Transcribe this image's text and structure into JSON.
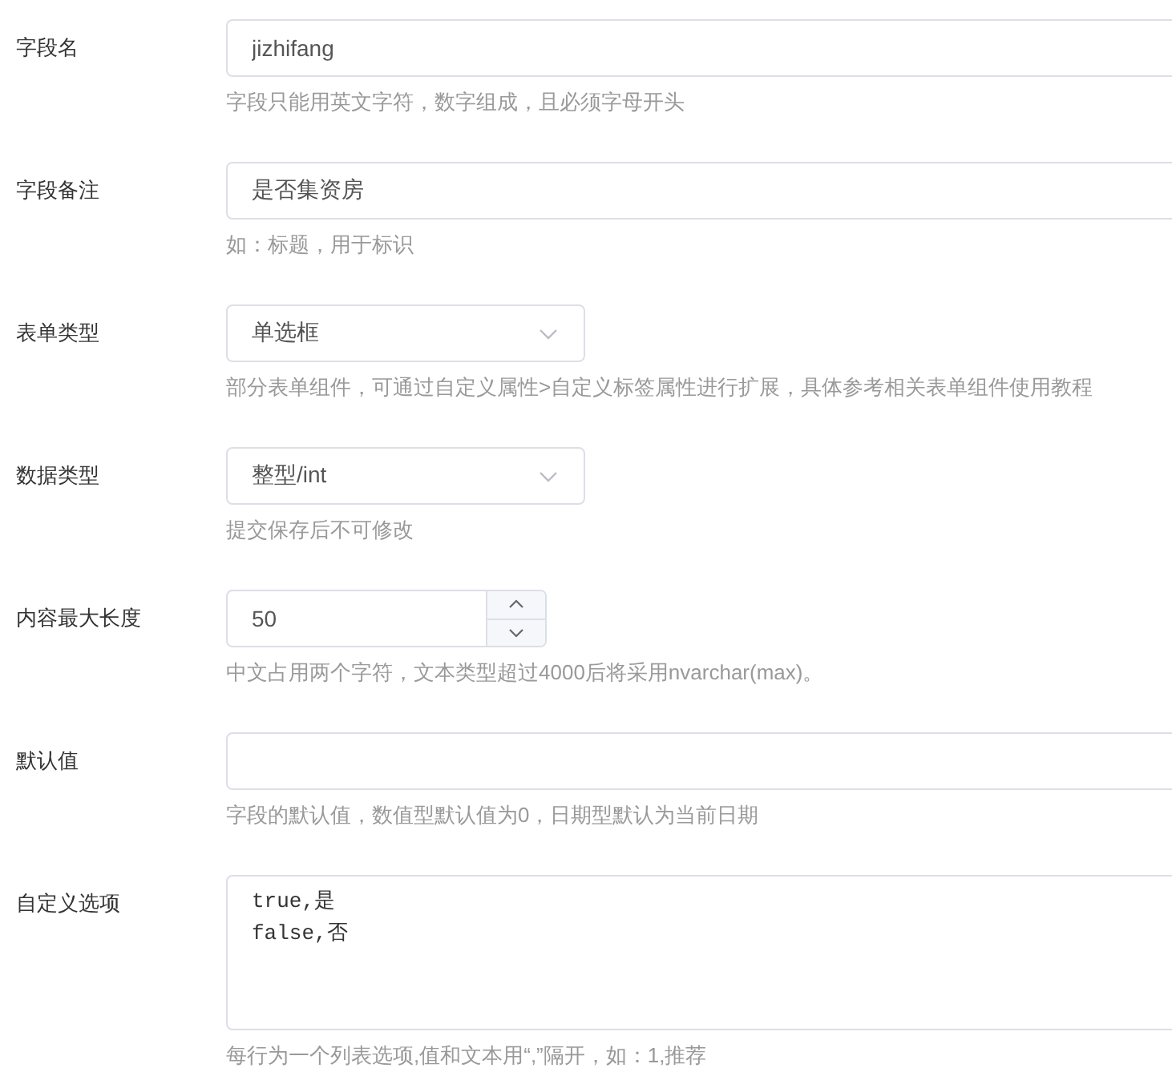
{
  "fields": [
    {
      "kind": "text",
      "label": "字段名",
      "value": "jizhifang",
      "help": "字段只能用英文字符，数字组成，且必须字母开头"
    },
    {
      "kind": "text",
      "label": "字段备注",
      "value": "是否集资房",
      "help": "如：标题，用于标识"
    },
    {
      "kind": "select",
      "label": "表单类型",
      "value": "单选框",
      "help": "部分表单组件，可通过自定义属性>自定义标签属性进行扩展，具体参考相关表单组件使用教程"
    },
    {
      "kind": "select",
      "label": "数据类型",
      "value": "整型/int",
      "help": "提交保存后不可修改"
    },
    {
      "kind": "number",
      "label": "内容最大长度",
      "value": "50",
      "help": "中文占用两个字符，文本类型超过4000后将采用nvarchar(max)。"
    },
    {
      "kind": "text",
      "label": "默认值",
      "help": "字段的默认值，数值型默认值为0，日期型默认为当前日期"
    },
    {
      "kind": "textarea",
      "label": "自定义选项",
      "value": "true,是\nfalse,否",
      "help": "每行为一个列表选项,值和文本用“,”隔开，如：1,推荐"
    }
  ]
}
